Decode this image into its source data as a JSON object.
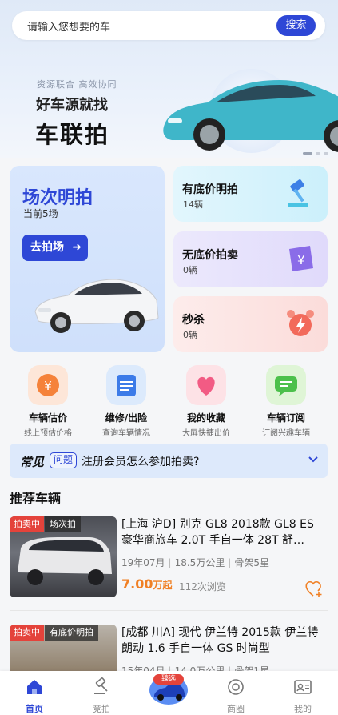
{
  "search": {
    "placeholder": "请输入您想要的车",
    "button": "搜索"
  },
  "banner": {
    "tagline": "资源联合 高效协同",
    "slogan": "好车源就找",
    "brand": "车联拍",
    "slide_count": 3,
    "active_slide": 1
  },
  "feature": {
    "title": "场次明拍",
    "subtitle": "当前5场",
    "button": "去拍场"
  },
  "cards": [
    {
      "title": "有底价明拍",
      "count": "14辆",
      "icon": "gavel-icon"
    },
    {
      "title": "无底价拍卖",
      "count": "0辆",
      "icon": "yen-tag-icon"
    },
    {
      "title": "秒杀",
      "count": "0辆",
      "icon": "alarm-clock-icon"
    }
  ],
  "quick": [
    {
      "label": "车辆估价",
      "sub": "线上预估价格",
      "icon": "yen-coin-icon"
    },
    {
      "label": "维修/出险",
      "sub": "查询车辆情况",
      "icon": "calendar-report-icon"
    },
    {
      "label": "我的收藏",
      "sub": "大屏快捷出价",
      "icon": "heart-icon"
    },
    {
      "label": "车辆订阅",
      "sub": "订阅兴趣车辆",
      "icon": "chat-icon"
    }
  ],
  "notice": {
    "brand": "常见",
    "tag": "问题",
    "text": "注册会员怎么参加拍卖?"
  },
  "section_title": "推荐车辆",
  "listings": [
    {
      "status": "拍卖中",
      "kind": "场次拍",
      "title": "[上海 沪D] 别克 GL8 2018款 GL8 ES 豪华商旅车 2.0T 手自一体 28T 舒…",
      "year": "19年07月",
      "mileage": "18.5万公里",
      "frame": "骨架5星",
      "price": "7.00",
      "price_unit": "万起",
      "views": "112次浏览"
    },
    {
      "status": "拍卖中",
      "kind": "有底价明拍",
      "title": "[成都 川A] 现代 伊兰特 2015款 伊兰特 朗动 1.6 手自一体 GS 时尚型",
      "year": "15年04月",
      "mileage": "14.0万公里",
      "frame": "骨架1星"
    }
  ],
  "tabs": [
    {
      "label": "首页",
      "icon": "home-icon",
      "active": true
    },
    {
      "label": "竞拍",
      "icon": "gavel-icon",
      "active": false
    },
    {
      "label": "",
      "badge": "臻选",
      "icon": "car-icon",
      "active": false
    },
    {
      "label": "商圈",
      "icon": "compass-icon",
      "active": false
    },
    {
      "label": "我的",
      "icon": "profile-card-icon",
      "active": false
    }
  ],
  "colors": {
    "accent": "#2e47d6",
    "price": "#f08025",
    "badge_red": "#e4433b"
  }
}
